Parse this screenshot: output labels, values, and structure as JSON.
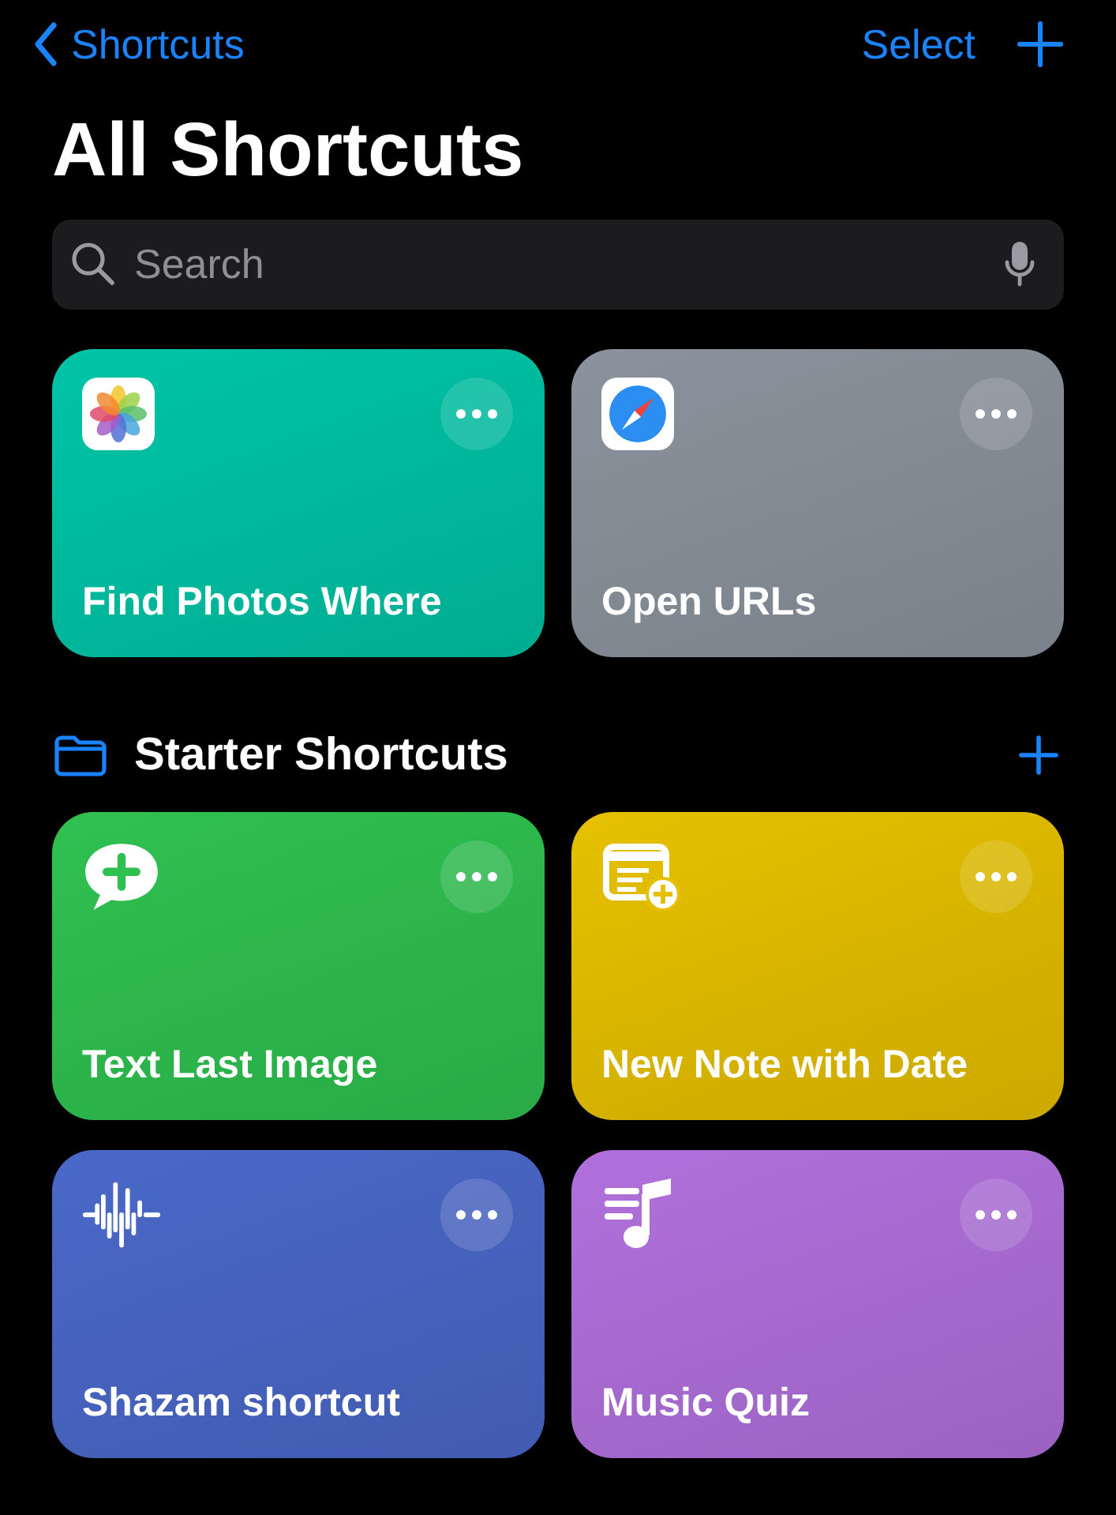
{
  "nav": {
    "back_label": "Shortcuts",
    "select_label": "Select"
  },
  "title": "All Shortcuts",
  "search": {
    "placeholder": "Search"
  },
  "shortcuts": [
    {
      "name": "Find Photos Where",
      "kind": "photos",
      "color": "#00c4a6"
    },
    {
      "name": "Open URLs",
      "kind": "safari",
      "color": "#8a939d"
    }
  ],
  "folder": {
    "title": "Starter Shortcuts"
  },
  "starter_shortcuts": [
    {
      "name": "Text Last Image",
      "kind": "message",
      "color": "#2fc150"
    },
    {
      "name": "New Note with Date",
      "kind": "note",
      "color": "#e6c000"
    },
    {
      "name": "Shazam shortcut",
      "kind": "waveform",
      "color": "#4a68c8"
    },
    {
      "name": "Music Quiz",
      "kind": "music",
      "color": "#b070dc"
    }
  ]
}
